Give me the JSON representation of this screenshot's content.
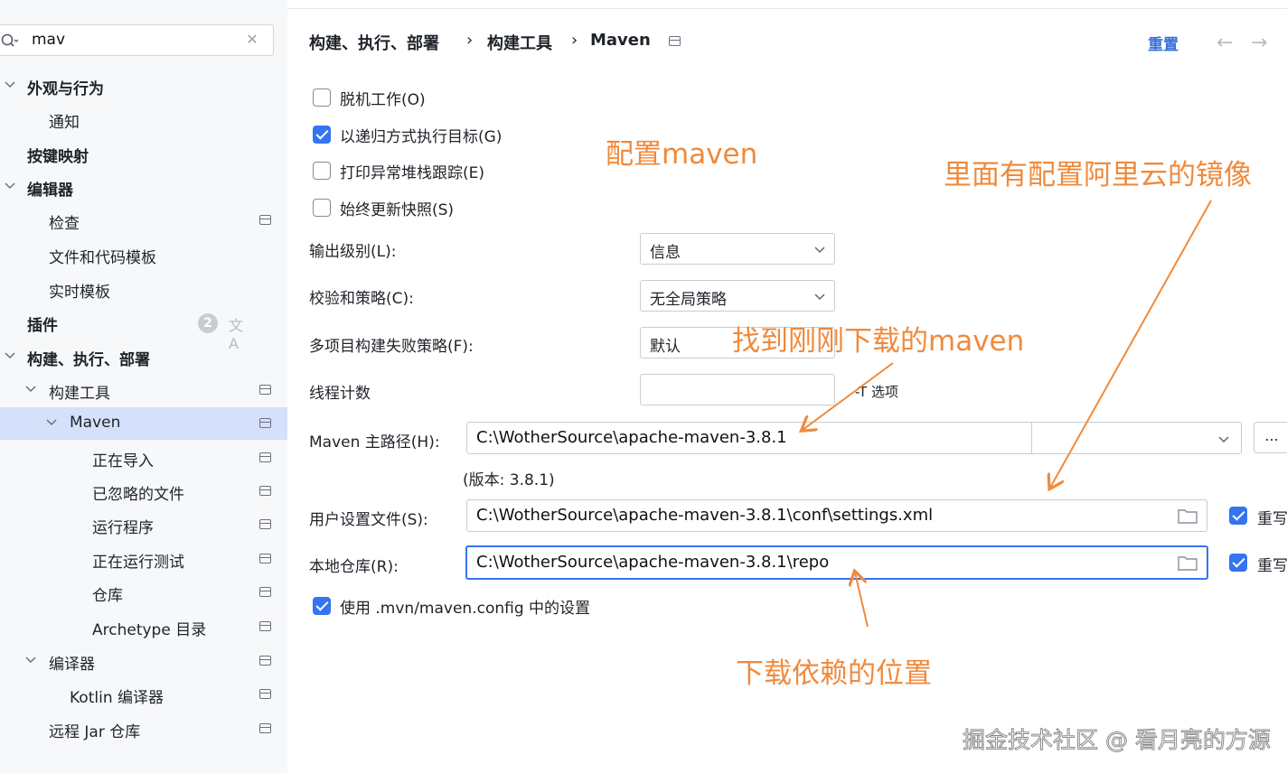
{
  "search": {
    "value": "mav"
  },
  "sidebar": {
    "items": [
      {
        "label": "外观与行为",
        "bold": true,
        "chevron": "down"
      },
      {
        "label": "通知"
      },
      {
        "label": "按键映射",
        "bold": true
      },
      {
        "label": "编辑器",
        "bold": true,
        "chevron": "down"
      },
      {
        "label": "检查",
        "pin": true
      },
      {
        "label": "文件和代码模板"
      },
      {
        "label": "实时模板"
      },
      {
        "label": "插件",
        "bold": true,
        "badge": "2"
      },
      {
        "label": "构建、执行、部署",
        "bold": true,
        "chevron": "down"
      },
      {
        "label": "构建工具",
        "chevron": "down",
        "pin": true
      },
      {
        "label": "Maven",
        "chevron": "down",
        "pin": true,
        "selected": true
      },
      {
        "label": "正在导入",
        "pin": true
      },
      {
        "label": "已忽略的文件",
        "pin": true
      },
      {
        "label": "运行程序",
        "pin": true
      },
      {
        "label": "正在运行测试",
        "pin": true
      },
      {
        "label": "仓库",
        "pin": true
      },
      {
        "label": "Archetype 目录",
        "pin": true
      },
      {
        "label": "编译器",
        "chevron": "down",
        "pin": true
      },
      {
        "label": "Kotlin 编译器",
        "pin": true
      },
      {
        "label": "远程 Jar 仓库",
        "pin": true
      }
    ],
    "plugin_badge": "2"
  },
  "breadcrumb": {
    "items": [
      "构建、执行、部署",
      "构建工具",
      "Maven"
    ],
    "separator": "›"
  },
  "header": {
    "reset_label": "重置",
    "back_icon": "arrow-left-icon",
    "forward_icon": "arrow-right-icon"
  },
  "options": {
    "offline": {
      "label": "脱机工作(O)",
      "checked": false
    },
    "recursive": {
      "label": "以递归方式执行目标(G)",
      "checked": true
    },
    "print_stack": {
      "label": "打印异常堆栈跟踪(E)",
      "checked": false
    },
    "update_snapshots": {
      "label": "始终更新快照(S)",
      "checked": false
    },
    "use_mvn_config": {
      "label": "使用 .mvn/maven.config 中的设置",
      "checked": true
    }
  },
  "fields": {
    "output_level": {
      "label": "输出级别(L):",
      "value": "信息"
    },
    "checksum_policy": {
      "label": "校验和策略(C):",
      "value": "无全局策略"
    },
    "multiproject_fail": {
      "label": "多项目构建失败策略(F):",
      "value": "默认"
    },
    "thread_count": {
      "label": "线程计数",
      "value": "",
      "suffix": "-T 选项"
    },
    "maven_home": {
      "label": "Maven 主路径(H):",
      "value": "C:\\WotherSource\\apache-maven-3.8.1",
      "browse_label": "...",
      "version": "(版本: 3.8.1)"
    },
    "user_settings": {
      "label": "用户设置文件(S):",
      "value": "C:\\WotherSource\\apache-maven-3.8.1\\conf\\settings.xml",
      "override_label": "重写",
      "override_checked": true
    },
    "local_repo": {
      "label": "本地仓库(R):",
      "value": "C:\\WotherSource\\apache-maven-3.8.1\\repo",
      "override_label": "重写",
      "override_checked": true
    }
  },
  "annotations": {
    "config_maven": "配置maven",
    "aliyun_mirror": "里面有配置阿里云的镜像",
    "find_maven": "找到刚刚下载的maven",
    "download_location": "下载依赖的位置",
    "color": "#f08a3c"
  },
  "watermark": "掘金技术社区 @ 看月亮的方源"
}
